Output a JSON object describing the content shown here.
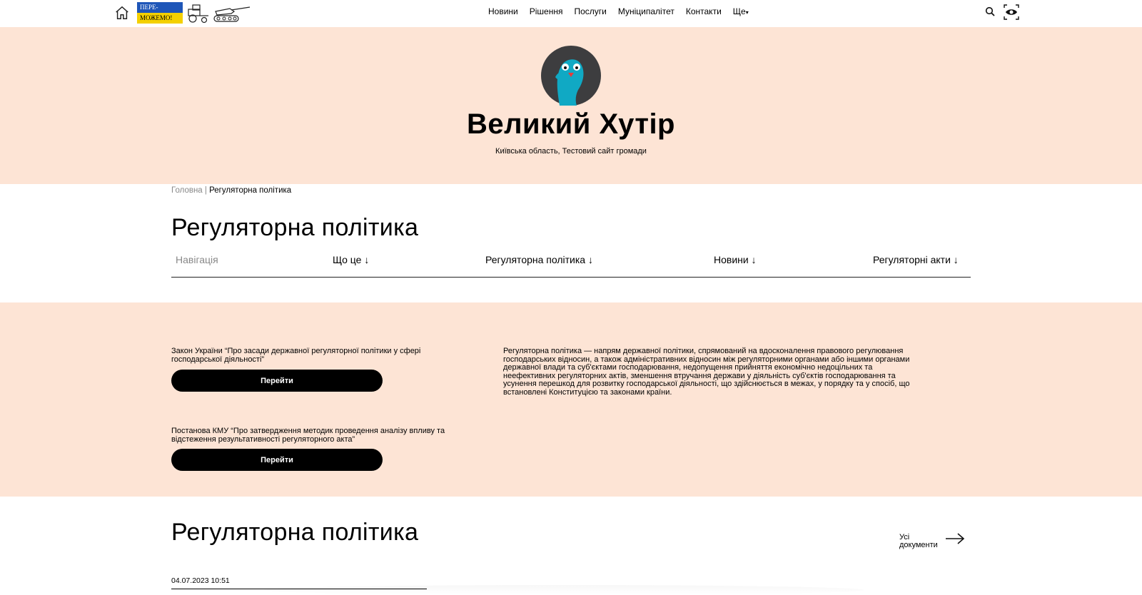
{
  "header": {
    "flag_text_top": "ПЕРЕ-",
    "flag_text_bottom": "МОЖЕМО!",
    "nav": [
      "Новини",
      "Рішення",
      "Послуги",
      "Муніципалітет",
      "Контакти"
    ],
    "more_label": "Ще",
    "icons": [
      "home-icon",
      "search-icon",
      "accessibility-eye-icon"
    ]
  },
  "hero": {
    "title": "Великий Хутір",
    "subtitle": "Київська область, Тестовий сайт громади"
  },
  "breadcrumb": {
    "home": "Головна",
    "separator": "|",
    "current": "Регуляторна політика"
  },
  "page": {
    "title": "Регуляторна політика",
    "tabs": {
      "nav_label": "Навігація",
      "what": "Що це ↓",
      "policy": "Регуляторна політика ↓",
      "news": "Новини ↓",
      "acts": "Регуляторні акти ↓"
    }
  },
  "docs": {
    "law_text": "Закон України “Про засади державної регуляторної політики у сфері господарської діяльності”",
    "law_button": "Перейти",
    "kmu_text": "Постанова КМУ “Про затвердження методик проведення аналізу впливу та відстеження результативності регуляторного акта”",
    "kmu_button": "Перейти",
    "description": "Регуляторна політика — напрям державної політики, спрямований на вдосконалення правового регулювання господарських відносин, а також адміністративних відносин між регуляторними органами або іншими органами державної влади та суб'єктами господарювання, недопущення прийняття економічно недоцільних та неефективних регуляторних актів, зменшення втручання держави у діяльність суб'єктів господарювання та усунення перешкод для розвитку господарської діяльності, що здійснюється в межах, у порядку та у спосіб, що встановлені Конституцією та законами країни."
  },
  "section": {
    "title": "Регуляторна політика",
    "all_docs_line1": "Усі",
    "all_docs_line2": "документи",
    "date": "04.07.2023 10:51"
  },
  "colors": {
    "accent_bg": "#fde4d5",
    "button_bg": "#000000",
    "flag_blue": "#1f56b8",
    "flag_yellow": "#f4d000",
    "logo_bird": "#10a9c4"
  }
}
